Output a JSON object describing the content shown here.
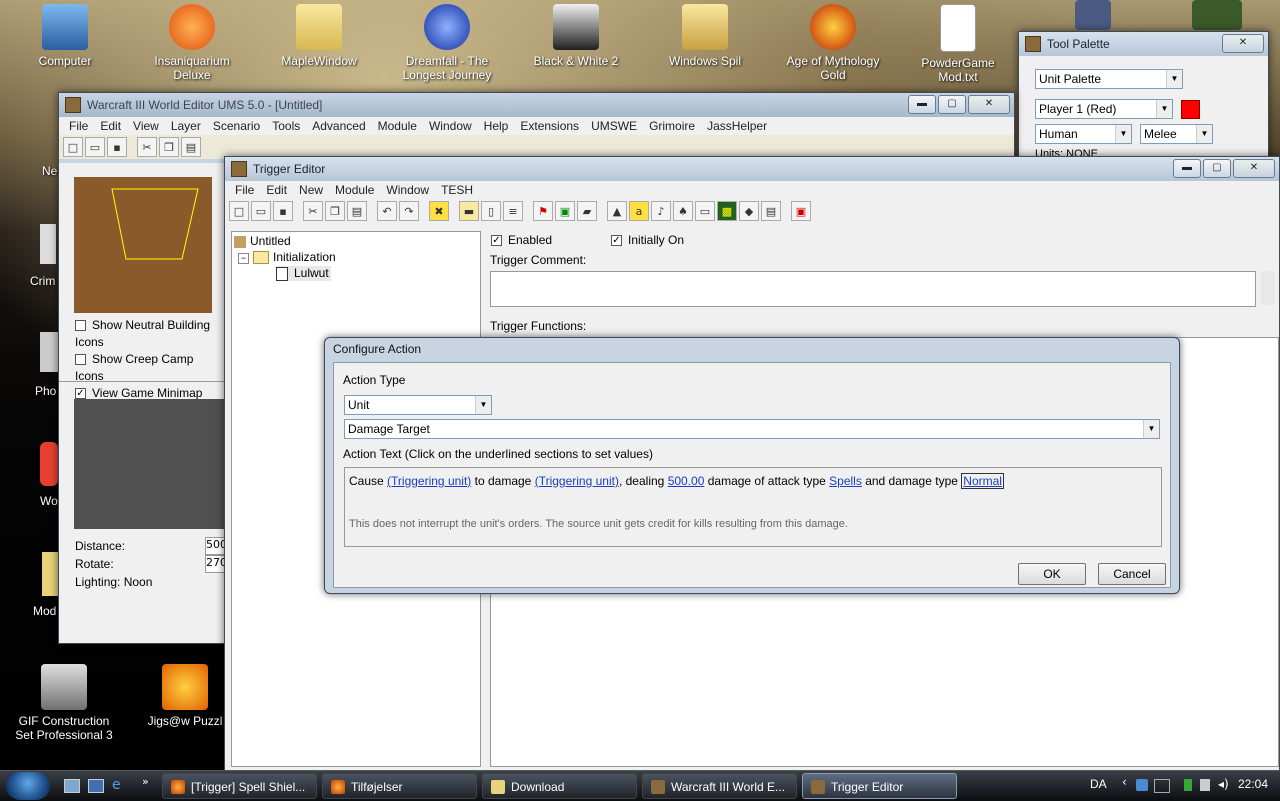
{
  "desktop": {
    "icons": [
      {
        "label": "Computer",
        "color": "#3a7fd0"
      },
      {
        "label": "Insaniquarium Deluxe",
        "color": "#f08020"
      },
      {
        "label": "MapleWindow",
        "color": "#e8d27a"
      },
      {
        "label": "Dreamfall - The Longest Journey",
        "color": "#2040c0"
      },
      {
        "label": "Black & White 2",
        "color": "#e0e0e0"
      },
      {
        "label": "Windows Spil",
        "color": "#e8d27a"
      },
      {
        "label": "Age of Mythology Gold",
        "color": "#e06010"
      },
      {
        "label": "PowderGame Mod.txt",
        "color": "#ffffff"
      }
    ],
    "bottom_icons": [
      {
        "label": "GIF Construction Set Professional 3"
      },
      {
        "label": "Jigs@w Puzzl"
      }
    ],
    "partial_labels": [
      "Ne",
      "Crim",
      "Pho",
      "Wo",
      "Mod"
    ]
  },
  "tool_palette": {
    "title": "Tool Palette",
    "palette_select": "Unit Palette",
    "player_select": "Player 1 (Red)",
    "player_color": "#ff0000",
    "race_select": "Human",
    "mode_select": "Melee",
    "units_text": "Units: NONE"
  },
  "world_editor": {
    "title": "Warcraft III World Editor UMS 5.0 - [Untitled]",
    "menu": [
      "File",
      "Edit",
      "View",
      "Layer",
      "Scenario",
      "Tools",
      "Advanced",
      "Module",
      "Window",
      "Help",
      "Extensions",
      "UMSWE",
      "Grimoire",
      "JassHelper"
    ],
    "checkboxes": [
      {
        "label": "Show Neutral Building Icons",
        "checked": false
      },
      {
        "label": "Show Creep Camp Icons",
        "checked": false
      },
      {
        "label": "View Game Minimap",
        "checked": true
      }
    ],
    "fields": [
      {
        "label": "Distance:",
        "value": "500"
      },
      {
        "label": "Rotate:",
        "value": "270"
      }
    ],
    "lighting": "Lighting: Noon"
  },
  "trigger_editor": {
    "title": "Trigger Editor",
    "menu": [
      "File",
      "Edit",
      "New",
      "Module",
      "Window",
      "TESH"
    ],
    "tree": {
      "root": "Untitled",
      "category": "Initialization",
      "trigger": "Lulwut"
    },
    "enabled_label": "Enabled",
    "initially_on_label": "Initially On",
    "comment_label": "Trigger Comment:",
    "functions_label": "Trigger Functions:"
  },
  "configure_action": {
    "title": "Configure Action",
    "action_type_label": "Action Type",
    "category_select": "Unit",
    "action_select": "Damage Target",
    "action_text_label": "Action Text (Click on the underlined sections to set values)",
    "text": {
      "p1": "Cause",
      "l1": "(Triggering unit)",
      "p2": "to damage",
      "l2": "(Triggering unit)",
      "p3": ", dealing",
      "l3": "500.00",
      "p4": "damage of attack type",
      "l4": "Spells",
      "p5": "and damage type",
      "l5": "Normal"
    },
    "description": "This does not interrupt the unit's orders.  The source unit gets credit for kills resulting from this damage.",
    "ok_label": "OK",
    "cancel_label": "Cancel"
  },
  "taskbar": {
    "tasks": [
      {
        "label": "[Trigger] Spell Shiel...",
        "active": false
      },
      {
        "label": "Tilføjelser",
        "active": false
      },
      {
        "label": "Download",
        "active": false
      },
      {
        "label": "Warcraft III World E...",
        "active": false
      },
      {
        "label": "Trigger Editor",
        "active": true
      }
    ],
    "language": "DA",
    "clock": "22:04"
  }
}
